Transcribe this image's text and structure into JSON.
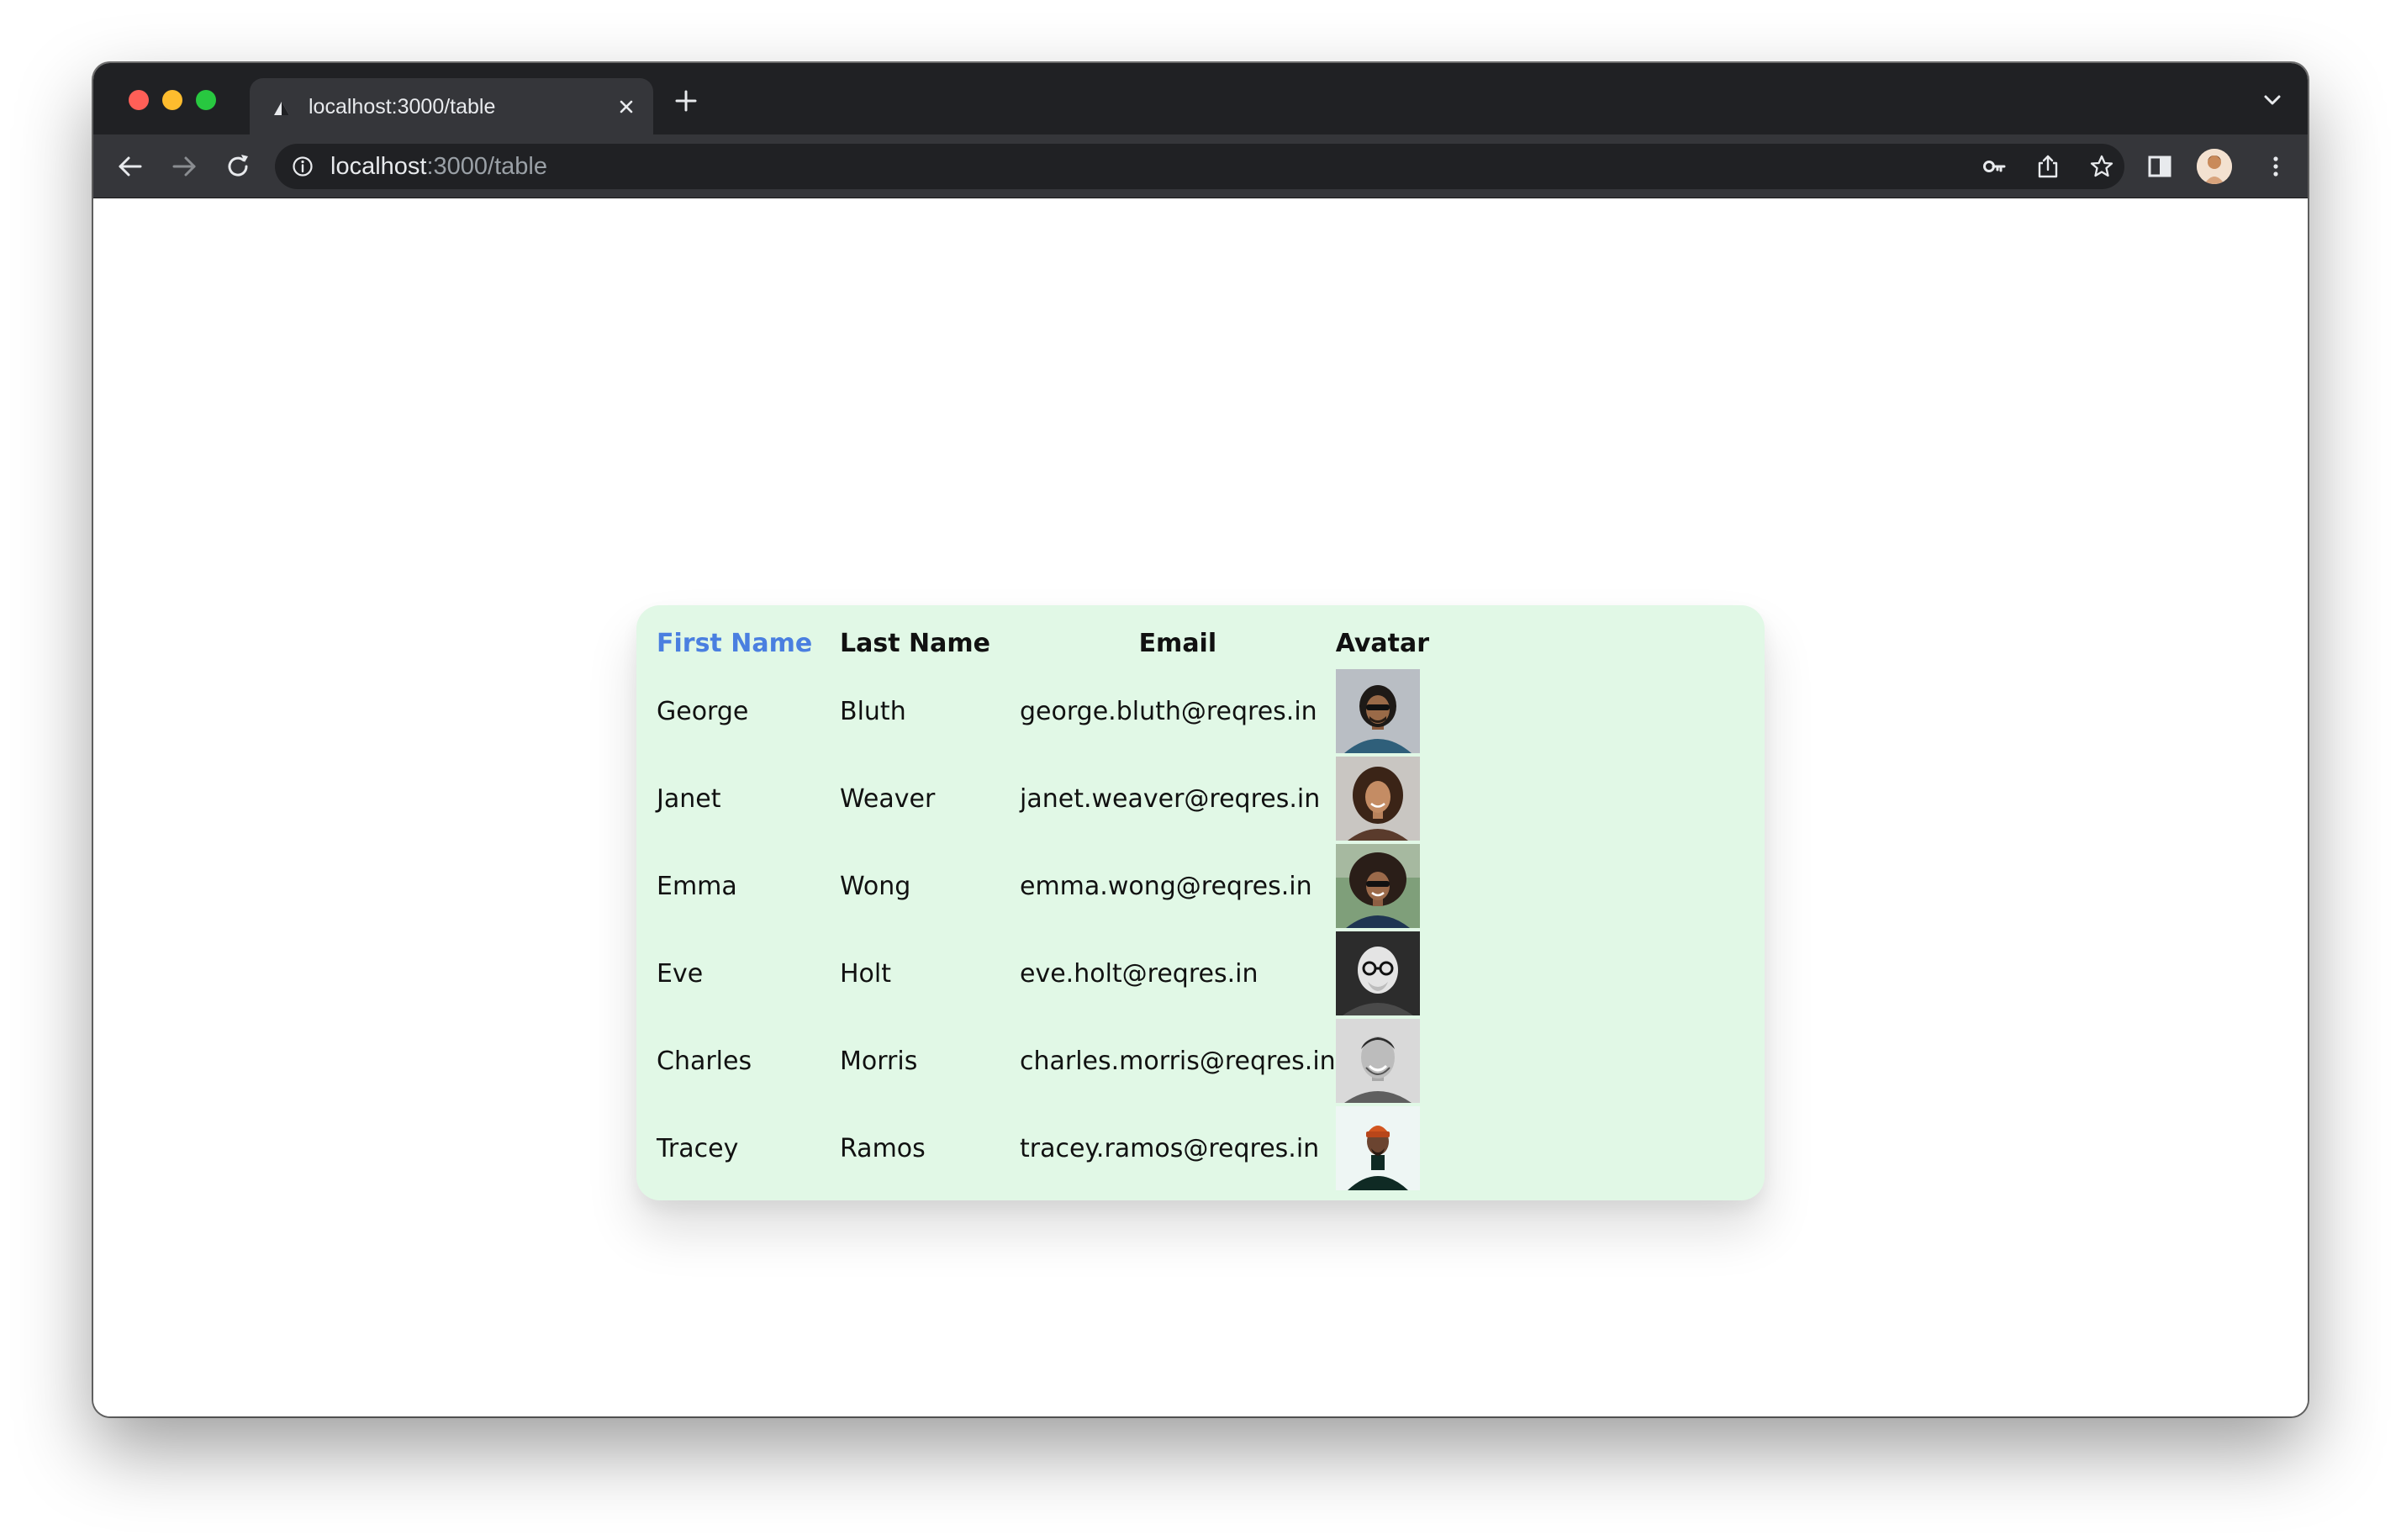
{
  "browser": {
    "tab": {
      "title": "localhost:3000/table"
    },
    "address": {
      "host": "localhost",
      "path": ":3000/table"
    }
  },
  "table": {
    "headers": {
      "first_name": "First Name",
      "last_name": "Last Name",
      "email": "Email",
      "avatar": "Avatar"
    },
    "rows": [
      {
        "first": "George",
        "last": "Bluth",
        "email": "george.bluth@reqres.in"
      },
      {
        "first": "Janet",
        "last": "Weaver",
        "email": "janet.weaver@reqres.in"
      },
      {
        "first": "Emma",
        "last": "Wong",
        "email": "emma.wong@reqres.in"
      },
      {
        "first": "Eve",
        "last": "Holt",
        "email": "eve.holt@reqres.in"
      },
      {
        "first": "Charles",
        "last": "Morris",
        "email": "charles.morris@reqres.in"
      },
      {
        "first": "Tracey",
        "last": "Ramos",
        "email": "tracey.ramos@reqres.in"
      }
    ]
  },
  "colors": {
    "card_background": "#e1f8e6",
    "sorted_header": "#4a7fe0",
    "browser_chrome": "#35363a"
  }
}
